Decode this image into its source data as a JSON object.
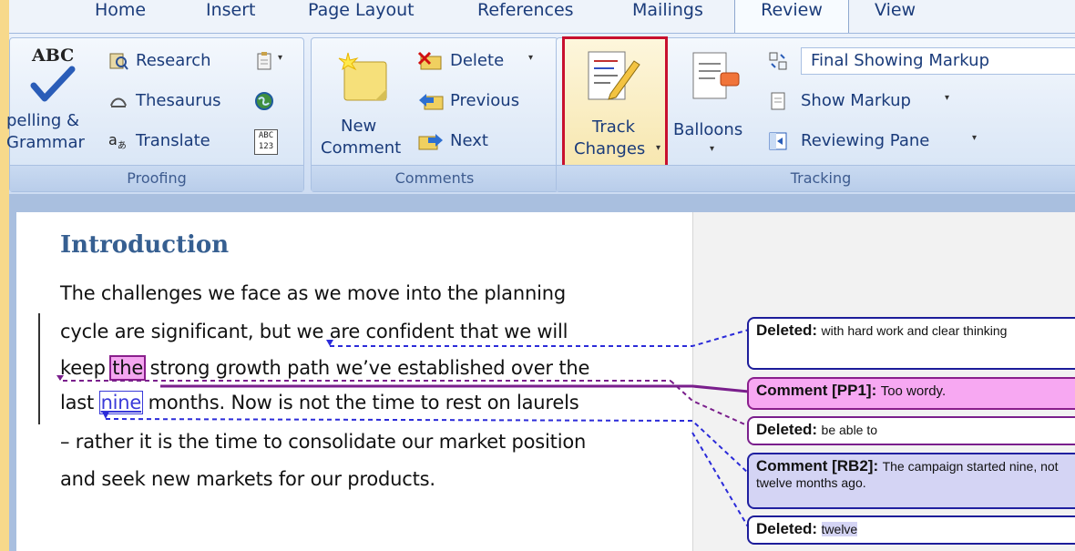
{
  "tabs": [
    "Home",
    "Insert",
    "Page Layout",
    "References",
    "Mailings",
    "Review",
    "View"
  ],
  "active_tab": "Review",
  "proofing": {
    "spelling_icon_text": "ABC",
    "spelling_line1": "pelling &",
    "spelling_line2": "Grammar",
    "research": "Research",
    "thesaurus": "Thesaurus",
    "translate": "Translate",
    "wordcount_icon_text": "ABC\n123",
    "group_label": "Proofing"
  },
  "comments": {
    "new_line1": "New",
    "new_line2": "Comment",
    "delete": "Delete",
    "previous": "Previous",
    "next": "Next",
    "group_label": "Comments"
  },
  "tracking": {
    "track_line1": "Track",
    "track_line2": "Changes",
    "balloons": "Balloons",
    "display_select": "Final Showing Markup",
    "show_markup": "Show Markup",
    "reviewing_pane": "Reviewing Pane",
    "group_label": "Tracking"
  },
  "document": {
    "heading": "Introduction",
    "line1": "The challenges we face as we move into the planning",
    "line2": "cycle are significant, but we are confident that we will",
    "line3_pre": "keep ",
    "line3_hl": "the",
    "line3_post": " strong growth path we’ve established over the",
    "line4_pre": "last ",
    "line4_hl": "nine",
    "line4_post": " months.  Now is not the time to rest on laurels",
    "line5": "– rather it is the time to consolidate our market position",
    "line6": "and seek new markets for our products."
  },
  "balloons": [
    {
      "label": "Deleted:",
      "text": "with hard work and clear thinking"
    },
    {
      "label": "Comment [PP1]:",
      "text": "Too wordy."
    },
    {
      "label": "Deleted:",
      "text": "be able to"
    },
    {
      "label": "Comment [RB2]:",
      "text": "The campaign started nine,  not twelve months ago."
    },
    {
      "label": "Deleted:",
      "text": "twelve"
    }
  ],
  "colors": {
    "accent_red": "#c8102e",
    "comment_pp": "#f7a8f2",
    "comment_rb": "#d4d4f4",
    "heading_blue": "#365f91"
  }
}
